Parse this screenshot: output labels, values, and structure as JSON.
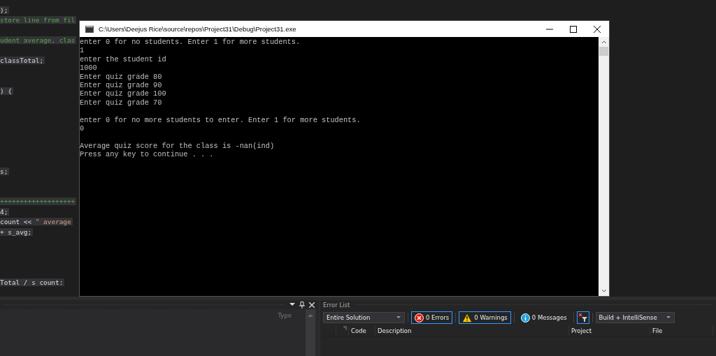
{
  "editor": {
    "lines": [
      {
        "segments": [
          {
            "kind": "code",
            "text": ");"
          }
        ]
      },
      {
        "segments": [
          {
            "kind": "comment",
            "text": "store line from fil"
          }
        ]
      },
      {
        "segments": [
          {
            "kind": "comment",
            "text": "udent average, clas"
          }
        ]
      },
      {
        "segments": [
          {
            "kind": "code",
            "text": "classTotal;"
          }
        ]
      },
      {
        "segments": [
          {
            "kind": "code",
            "text": ") {"
          }
        ]
      },
      {
        "segments": [
          {
            "kind": "code",
            "text": "s;"
          }
        ]
      },
      {
        "segments": [
          {
            "kind": "comment",
            "text": "+++++++++++++++++++"
          }
        ]
      },
      {
        "segments": [
          {
            "kind": "code",
            "text": "4;"
          }
        ]
      },
      {
        "segments": [
          {
            "kind": "code",
            "text": "count << "
          },
          {
            "kind": "string",
            "text": "\" average"
          }
        ]
      },
      {
        "segments": [
          {
            "kind": "code",
            "text": "+ s_avg;"
          }
        ]
      },
      {
        "segments": [
          {
            "kind": "code",
            "text": "Total / s count:"
          }
        ]
      }
    ]
  },
  "console": {
    "title": "C:\\Users\\Deejus Rice\\source\\repos\\Project31\\Debug\\Project31.exe",
    "output_blocks": [
      [
        "enter 0 for no students. Enter 1 for more students.",
        "1",
        "enter the student id",
        "1000",
        "Enter quiz grade 80",
        "Enter quiz grade 90",
        "Enter quiz grade 100",
        "Enter quiz grade 70"
      ],
      [
        "enter 0 for no more students to enter. Enter 1 for more students.",
        "0"
      ],
      [
        "Average quiz score for the class is -nan(ind)",
        "Press any key to continue . . ."
      ]
    ]
  },
  "left_panel": {
    "column": "Type"
  },
  "error_list": {
    "title": "Error List",
    "scope": "Entire Solution",
    "filters": [
      {
        "kind": "error",
        "label": "0 Errors",
        "selected": true
      },
      {
        "kind": "warning",
        "label": "0 Warnings",
        "selected": true
      },
      {
        "kind": "message",
        "label": "0 Messages",
        "selected": false
      }
    ],
    "clear_filter_selected": true,
    "source": "Build + IntelliSense",
    "columns": [
      "Code",
      "Description",
      "Project",
      "File"
    ]
  }
}
